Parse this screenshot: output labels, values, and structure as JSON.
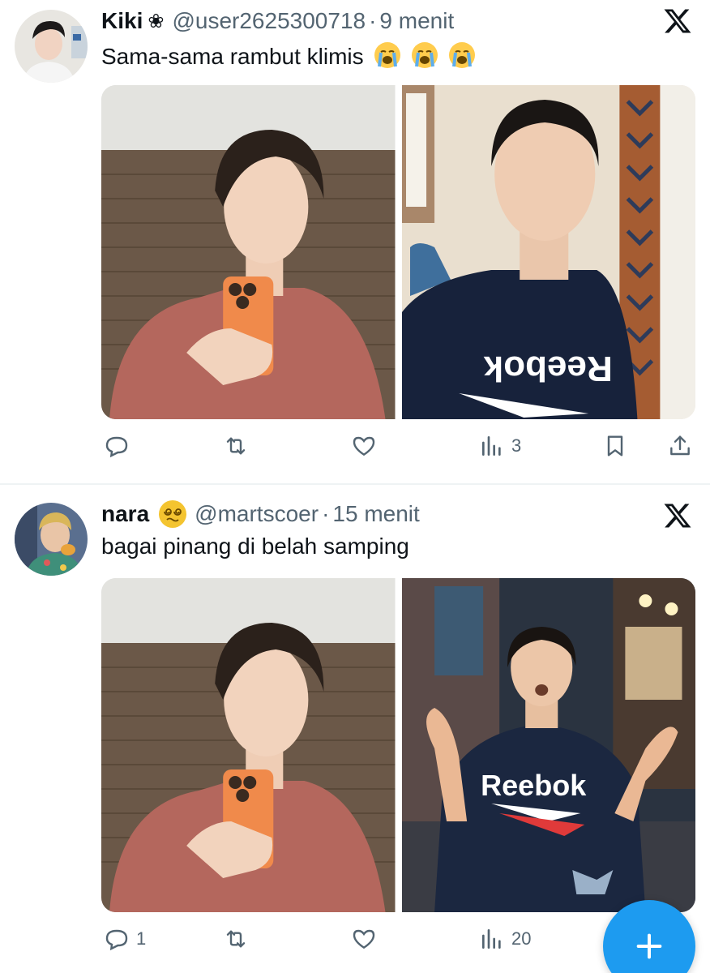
{
  "tweets": [
    {
      "name": "Kiki",
      "name_decoration": "❀",
      "handle": "@user2625300718",
      "separator": "·",
      "time": "9 menit",
      "text": "Sama-sama rambut klimis",
      "text_emojis": [
        "loudly-crying-face",
        "loudly-crying-face",
        "loudly-crying-face"
      ],
      "images": [
        "mirror-selfie-orange-phone",
        "man-reebok-shirt-surprised"
      ],
      "actions": {
        "reply_count": "",
        "retweet_count": "",
        "like_count": "",
        "views_count": "3"
      }
    },
    {
      "name": "nara",
      "name_badge": "dizzy-face-emoji",
      "handle": "@martscoer",
      "separator": "·",
      "time": "15 menit",
      "text": "bagai pinang di belah samping",
      "images": [
        "mirror-selfie-orange-phone",
        "man-reebok-shirt-hands-raised"
      ],
      "actions": {
        "reply_count": "1",
        "retweet_count": "",
        "like_count": "",
        "views_count": "20"
      },
      "image_text": "Reebok"
    }
  ],
  "icons": {
    "brand": "x-logo",
    "reply": "reply-icon",
    "retweet": "retweet-icon",
    "like": "heart-icon",
    "views": "views-icon",
    "bookmark": "bookmark-icon",
    "share": "share-icon",
    "compose": "plus-icon"
  },
  "colors": {
    "text": "#0f1419",
    "secondary": "#536471",
    "accent": "#1d9bf0",
    "divider": "#eff3f4"
  }
}
